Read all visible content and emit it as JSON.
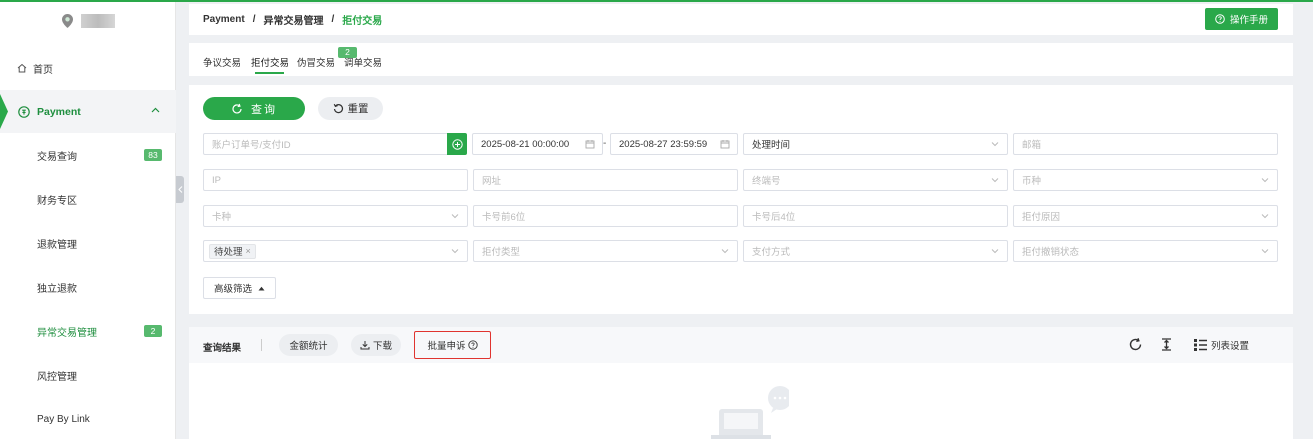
{
  "sidebar": {
    "home": "首页",
    "payment": "Payment",
    "items": [
      {
        "label": "交易查询",
        "badge": "83"
      },
      {
        "label": "财务专区",
        "badge": ""
      },
      {
        "label": "退款管理",
        "badge": ""
      },
      {
        "label": "独立退款",
        "badge": ""
      },
      {
        "label": "异常交易管理",
        "badge": "2"
      },
      {
        "label": "风控管理",
        "badge": ""
      },
      {
        "label": "Pay By Link",
        "badge": ""
      }
    ]
  },
  "header": {
    "breadcrumb": [
      "Payment",
      "异常交易管理",
      "拒付交易"
    ],
    "manual_button": "操作手册"
  },
  "tabs": [
    {
      "label": "争议交易"
    },
    {
      "label": "拒付交易"
    },
    {
      "label": "伪冒交易",
      "badge": "2"
    },
    {
      "label": "调单交易"
    }
  ],
  "search": {
    "query_button": "查询",
    "reset_button": "重置",
    "order_placeholder": "账户订单号/支付ID",
    "date_start": "2025-08-21 00:00:00",
    "date_end": "2025-08-27 23:59:59",
    "time_type": "处理时间",
    "email_placeholder": "邮箱",
    "ip_placeholder": "IP",
    "url_placeholder": "网址",
    "terminal_placeholder": "终端号",
    "currency_placeholder": "币种",
    "card_type_placeholder": "卡种",
    "card_first6_placeholder": "卡号前6位",
    "card_last4_placeholder": "卡号后4位",
    "reason_placeholder": "拒付原因",
    "status_chip": "待处理",
    "dispute_type_placeholder": "拒付类型",
    "pay_method_placeholder": "支付方式",
    "revoke_status_placeholder": "拒付撤销状态",
    "advanced_button": "高级筛选"
  },
  "results": {
    "title": "查询结果",
    "amount_stats": "金额统计",
    "download": "下载",
    "batch_appeal": "批量申诉",
    "list_settings": "列表设置"
  },
  "colors": {
    "brand": "#2aa84a",
    "highlight": "#e0342f"
  }
}
